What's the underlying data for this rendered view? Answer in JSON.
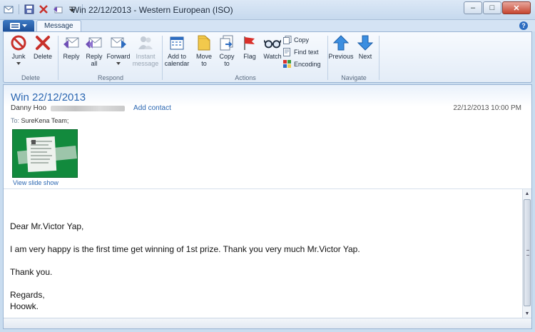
{
  "window": {
    "title": "Win 22/12/2013 - Western European (ISO)",
    "minimize": "–",
    "maximize": "□",
    "close": "✕"
  },
  "quick_access": {
    "icons": [
      "app-icon",
      "save-icon",
      "delete-icon",
      "reply-icon",
      "customize-icon"
    ]
  },
  "ribbon": {
    "tabs": [
      {
        "label": "Message"
      }
    ],
    "help": "?",
    "groups": [
      {
        "label": "Delete",
        "buttons": [
          {
            "label": "Junk",
            "icon": "junk-icon"
          },
          {
            "label": "Delete",
            "icon": "delete-icon"
          }
        ]
      },
      {
        "label": "Respond",
        "buttons": [
          {
            "label": "Reply",
            "icon": "reply-icon"
          },
          {
            "label": "Reply all",
            "line1": "Reply",
            "line2": "all",
            "icon": "reply-all-icon"
          },
          {
            "label": "Forward",
            "icon": "forward-icon"
          },
          {
            "label": "Instant message",
            "line1": "Instant",
            "line2": "message",
            "icon": "instant-message-icon",
            "disabled": true
          }
        ]
      },
      {
        "label": "Actions",
        "buttons": [
          {
            "label": "Add to calendar",
            "line1": "Add to",
            "line2": "calendar",
            "icon": "calendar-icon"
          },
          {
            "label": "Move to",
            "line1": "Move",
            "line2": "to",
            "icon": "move-folder-icon"
          },
          {
            "label": "Copy to",
            "line1": "Copy",
            "line2": "to",
            "icon": "copy-to-icon"
          },
          {
            "label": "Flag",
            "icon": "flag-icon"
          },
          {
            "label": "Watch",
            "icon": "watch-glasses-icon"
          }
        ],
        "small": [
          {
            "label": "Copy",
            "icon": "copy-icon"
          },
          {
            "label": "Find text",
            "icon": "find-text-icon"
          },
          {
            "label": "Encoding",
            "icon": "encoding-icon"
          }
        ]
      },
      {
        "label": "Navigate",
        "buttons": [
          {
            "label": "Previous",
            "icon": "up-arrow-icon"
          },
          {
            "label": "Next",
            "icon": "down-arrow-icon"
          }
        ]
      }
    ]
  },
  "message": {
    "subject": "Win 22/12/2013",
    "sender": "Danny Hoo",
    "add_contact": "Add contact",
    "datetime": "22/12/2013 10:00 PM",
    "to_label": "To:",
    "to_value": "SureKena Team;",
    "slideshow": "View slide show",
    "body": [
      "Dear Mr.Victor Yap,",
      "I am very happy is the first time get winning of 1st prize. Thank you very much Mr.Victor Yap.",
      "Thank you.",
      "Regards,",
      "Hoowk."
    ]
  },
  "colors": {
    "accent": "#2a66b1",
    "frame": "#c9dcef",
    "close": "#c6452f"
  }
}
